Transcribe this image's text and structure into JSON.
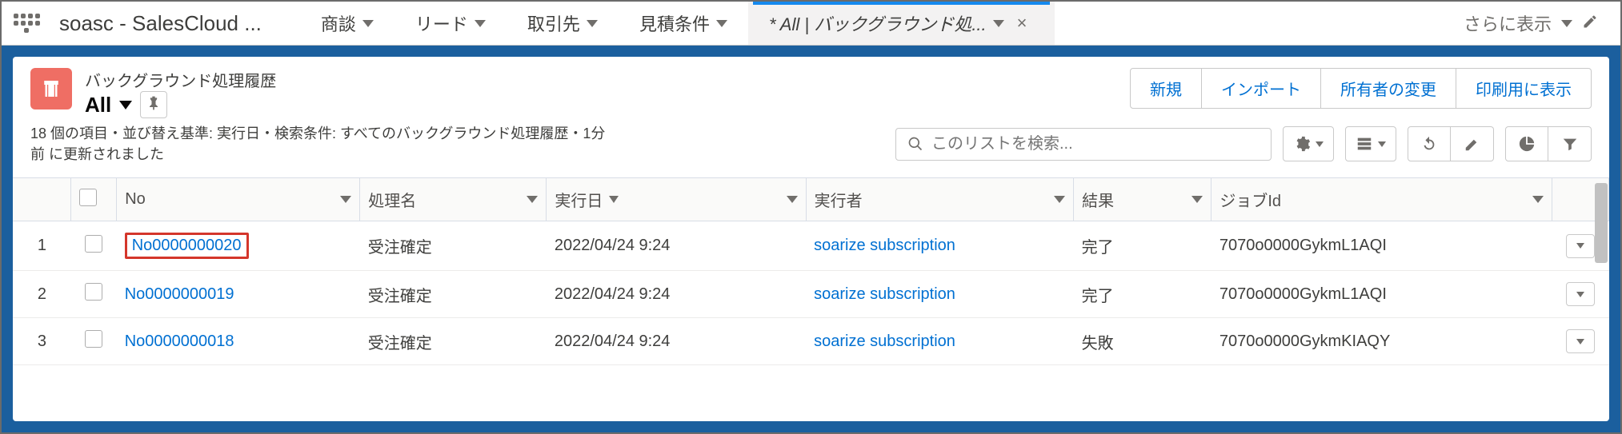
{
  "nav": {
    "app_title": "soasc - SalesCloud ...",
    "items": [
      {
        "label": "商談"
      },
      {
        "label": "リード"
      },
      {
        "label": "取引先"
      },
      {
        "label": "見積条件"
      }
    ],
    "active_tab_label": "* All | バックグラウンド処...",
    "more_label": "さらに表示"
  },
  "list": {
    "object_type": "バックグラウンド処理履歴",
    "view_name": "All",
    "meta_text": "18 個の項目・並び替え基準: 実行日・検索条件: すべてのバックグラウンド処理履歴・1分前 に更新されました",
    "header_actions": [
      "新規",
      "インポート",
      "所有者の変更",
      "印刷用に表示"
    ],
    "search_placeholder": "このリストを検索..."
  },
  "table": {
    "columns": {
      "no": "No",
      "proc_name": "処理名",
      "exec_date": "実行日",
      "executor": "実行者",
      "result": "結果",
      "job_id": "ジョブId"
    },
    "sorted_column": "exec_date",
    "rows": [
      {
        "idx": "1",
        "no": "No0000000020",
        "no_highlight": true,
        "proc_name": "受注確定",
        "exec_date": "2022/04/24 9:24",
        "executor": "soarize subscription",
        "result": "完了",
        "job_id": "7070o0000GykmL1AQI"
      },
      {
        "idx": "2",
        "no": "No0000000019",
        "no_highlight": false,
        "proc_name": "受注確定",
        "exec_date": "2022/04/24 9:24",
        "executor": "soarize subscription",
        "result": "完了",
        "job_id": "7070o0000GykmL1AQI"
      },
      {
        "idx": "3",
        "no": "No0000000018",
        "no_highlight": false,
        "proc_name": "受注確定",
        "exec_date": "2022/04/24 9:24",
        "executor": "soarize subscription",
        "result": "失敗",
        "job_id": "7070o0000GykmKIAQY"
      }
    ]
  }
}
